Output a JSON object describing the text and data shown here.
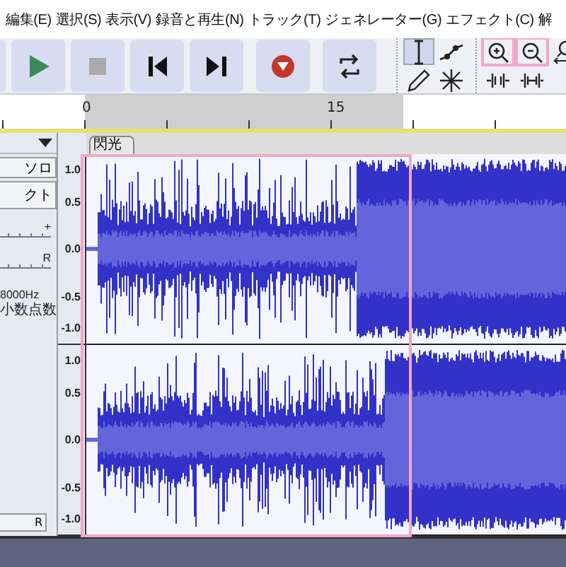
{
  "menu": [
    {
      "label": "編集(E)"
    },
    {
      "label": "選択(S)"
    },
    {
      "label": "表示(V)"
    },
    {
      "label": "録音と再生(N)"
    },
    {
      "label": "トラック(T)"
    },
    {
      "label": "ジェネレーター(G)"
    },
    {
      "label": "エフェクト(C)"
    },
    {
      "label": "解"
    }
  ],
  "transport": [
    {
      "kind": "play"
    },
    {
      "kind": "stop"
    },
    {
      "kind": "skip-start"
    },
    {
      "kind": "skip-end"
    },
    {
      "kind": "record"
    },
    {
      "kind": "loop"
    }
  ],
  "tools": [
    {
      "kind": "ibeam",
      "selected": true
    },
    {
      "kind": "envelope",
      "selected": false
    },
    {
      "kind": "pencil",
      "selected": false
    },
    {
      "kind": "multi",
      "selected": false
    }
  ],
  "zoom_tools": [
    {
      "kind": "zoom-in",
      "highlighted": true
    },
    {
      "kind": "zoom-out",
      "highlighted": true
    },
    {
      "kind": "zoom-fit",
      "highlighted": false
    },
    {
      "kind": "trim",
      "highlighted": false
    },
    {
      "kind": "silence",
      "highlighted": false
    }
  ],
  "timeline": {
    "ticks": [
      "0",
      "15"
    ]
  },
  "track": {
    "name": "閃光",
    "solo": "ソロ",
    "mute": "クト",
    "gain_mark": "+",
    "pan_mark": "R",
    "rate": "8000Hz",
    "format": "小数点数",
    "select": "R",
    "channels": [
      {
        "ruler": [
          "1.0",
          "0.5",
          "0.0",
          "-0.5",
          "-1.0"
        ]
      },
      {
        "ruler": [
          "1.0",
          "0.5",
          "0.0",
          "-0.5",
          "-1.0"
        ]
      }
    ]
  }
}
